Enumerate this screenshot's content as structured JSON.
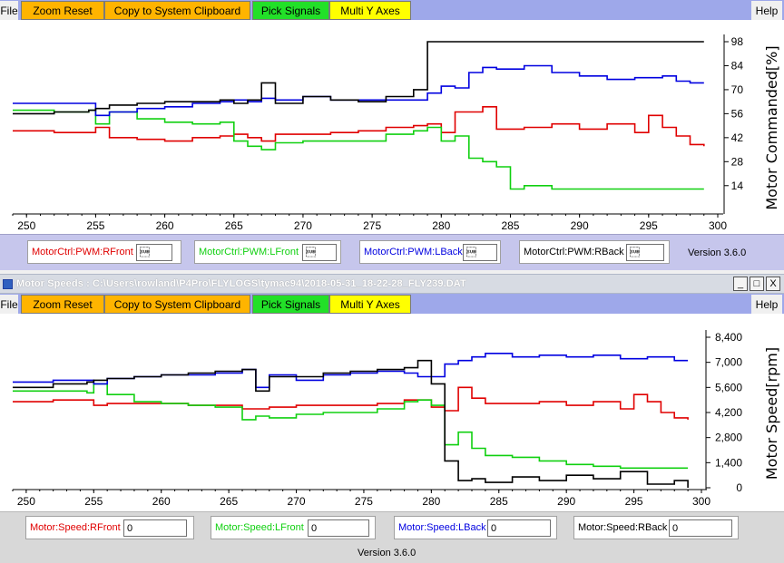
{
  "colors": {
    "rfront": "#e00000",
    "lfront": "#10d010",
    "lback": "#0000e0",
    "rback": "#000000"
  },
  "top_panel": {
    "menu": {
      "file": "File",
      "help": "Help"
    },
    "buttons": {
      "zoom_reset": "Zoom Reset",
      "copy": "Copy to System Clipboard",
      "pick": "Pick Signals",
      "multi": "Multi Y Axes"
    },
    "signals": [
      {
        "label": "MotorCtrl:PWM:RFront",
        "value": "\u001a"
      },
      {
        "label": "MotorCtrl:PWM:LFront",
        "value": "\u001a"
      },
      {
        "label": "MotorCtrl:PWM:LBack",
        "value": "\u001a"
      },
      {
        "label": "MotorCtrl:PWM:RBack",
        "value": "\u001a"
      }
    ],
    "version": "Version 3.6.0",
    "ylabel": "Motor Commanded[%]",
    "yticks": [
      "98",
      "84",
      "70",
      "56",
      "42",
      "28",
      "14"
    ],
    "xticks": [
      "250",
      "255",
      "260",
      "265",
      "270",
      "275",
      "280",
      "285",
      "290",
      "295",
      "300"
    ]
  },
  "window": {
    "title": "Motor Speeds : C:\\Users\\rowland\\P4Pro\\FLYLOGS\\tymac94\\2018-05-31_18-22-28_FLY239.DAT",
    "minimize": "_",
    "maximize": "□",
    "close": "X"
  },
  "bottom_panel": {
    "menu": {
      "file": "File",
      "help": "Help"
    },
    "buttons": {
      "zoom_reset": "Zoom Reset",
      "copy": "Copy to System Clipboard",
      "pick": "Pick Signals",
      "multi": "Multi Y Axes"
    },
    "signals": [
      {
        "label": "Motor:Speed:RFront",
        "value": "0"
      },
      {
        "label": "Motor:Speed:LFront",
        "value": "0"
      },
      {
        "label": "Motor:Speed:LBack",
        "value": "0"
      },
      {
        "label": "Motor:Speed:RBack",
        "value": "0"
      }
    ],
    "version": "Version 3.6.0",
    "ylabel": "Motor Speed[rpm]",
    "yticks": [
      "8,400",
      "7,000",
      "5,600",
      "4,200",
      "2,800",
      "1,400",
      "0"
    ],
    "xticks": [
      "250",
      "255",
      "260",
      "265",
      "270",
      "275",
      "280",
      "285",
      "290",
      "295",
      "300"
    ]
  },
  "chart_data": [
    {
      "type": "line",
      "ylabel": "Motor Commanded[%]",
      "xlim": [
        249,
        300
      ],
      "ylim": [
        7,
        98
      ],
      "series": [
        {
          "name": "MotorCtrl:PWM:RFront",
          "x": [
            249,
            252,
            254.5,
            255,
            256,
            258,
            260,
            262,
            264,
            265,
            266,
            267,
            268,
            270,
            272,
            274,
            276,
            278,
            279,
            280,
            281,
            282,
            283,
            284,
            286,
            288,
            290,
            292,
            294,
            295,
            296,
            297,
            298,
            299
          ],
          "y": [
            46,
            45,
            45,
            48,
            42,
            41,
            40,
            42,
            43,
            44,
            42,
            40,
            44,
            44,
            45,
            46,
            48,
            49,
            50,
            45,
            57,
            57,
            60,
            47,
            48,
            50,
            47,
            50,
            45,
            55,
            48,
            43,
            38,
            37
          ]
        },
        {
          "name": "MotorCtrl:PWM:LFront",
          "x": [
            249,
            252,
            254.5,
            255,
            256,
            258,
            260,
            262,
            264,
            265,
            266,
            267,
            268,
            270,
            272,
            274,
            276,
            278,
            279,
            280,
            281,
            282,
            283,
            284,
            285,
            286,
            288,
            290,
            292,
            294,
            296,
            297,
            298,
            299
          ],
          "y": [
            58,
            57,
            58,
            50,
            57,
            53,
            51,
            50,
            51,
            40,
            37,
            35,
            39,
            40,
            40,
            40,
            44,
            46,
            48,
            40,
            43,
            30,
            28,
            25,
            12,
            14,
            12,
            12,
            12,
            12,
            12,
            12,
            12,
            12
          ]
        },
        {
          "name": "MotorCtrl:PWM:LBack",
          "x": [
            249,
            252,
            254.5,
            255,
            256,
            258,
            260,
            262,
            264,
            265,
            266,
            267,
            268,
            270,
            272,
            274,
            276,
            278,
            279,
            280,
            281,
            282,
            283,
            284,
            286,
            288,
            290,
            292,
            294,
            296,
            297,
            298,
            299
          ],
          "y": [
            62,
            62,
            62,
            55,
            57,
            59,
            60,
            62,
            63,
            64,
            63,
            65,
            64,
            66,
            64,
            64,
            64,
            64,
            68,
            72,
            71,
            80,
            83,
            82,
            84,
            80,
            78,
            76,
            77,
            78,
            75,
            74,
            74
          ]
        },
        {
          "name": "MotorCtrl:PWM:RBack",
          "x": [
            249,
            252,
            254.5,
            255,
            256,
            258,
            260,
            262,
            264,
            265,
            266,
            267,
            268,
            270,
            272,
            274,
            276,
            278,
            279,
            280,
            281,
            282,
            283,
            284,
            286,
            288,
            290,
            292,
            294,
            296,
            298,
            299
          ],
          "y": [
            56,
            57,
            58,
            59,
            61,
            62,
            63,
            63,
            64,
            62,
            64,
            74,
            62,
            66,
            64,
            63,
            66,
            70,
            98,
            98,
            98,
            98,
            98,
            98,
            98,
            98,
            98,
            98,
            98,
            98,
            98,
            98
          ]
        }
      ]
    },
    {
      "type": "line",
      "ylabel": "Motor Speed[rpm]",
      "xlim": [
        249,
        300
      ],
      "ylim": [
        0,
        8400
      ],
      "series": [
        {
          "name": "Motor:Speed:RFront",
          "x": [
            249,
            252,
            254.5,
            255,
            256,
            258,
            260,
            262,
            264,
            266,
            268,
            270,
            272,
            274,
            276,
            278,
            279,
            280,
            281,
            282,
            283,
            284,
            286,
            288,
            290,
            292,
            294,
            295,
            296,
            297,
            298,
            299
          ],
          "y": [
            4800,
            4900,
            4900,
            4600,
            4700,
            4700,
            4700,
            4600,
            4600,
            4400,
            4500,
            4600,
            4600,
            4600,
            4700,
            4900,
            4900,
            4500,
            4300,
            5600,
            5000,
            4700,
            4700,
            4800,
            4600,
            4800,
            4400,
            5200,
            4800,
            4200,
            3900,
            3800
          ]
        },
        {
          "name": "Motor:Speed:LFront",
          "x": [
            249,
            252,
            254.5,
            255,
            256,
            258,
            260,
            262,
            264,
            266,
            267,
            268,
            270,
            272,
            274,
            276,
            278,
            279,
            280,
            281,
            282,
            283,
            284,
            286,
            288,
            290,
            292,
            294,
            296,
            298,
            299
          ],
          "y": [
            5400,
            5400,
            5300,
            5800,
            5200,
            4800,
            4700,
            4600,
            4500,
            3800,
            4000,
            3900,
            4100,
            4200,
            4200,
            4400,
            4800,
            4900,
            4600,
            2400,
            3100,
            2200,
            1800,
            1700,
            1500,
            1300,
            1200,
            1100,
            1100,
            1100,
            1100
          ]
        },
        {
          "name": "Motor:Speed:LBack",
          "x": [
            249,
            252,
            254.5,
            255,
            256,
            258,
            260,
            262,
            264,
            266,
            267,
            268,
            270,
            272,
            274,
            276,
            278,
            279,
            280,
            281,
            282,
            283,
            284,
            286,
            288,
            290,
            292,
            294,
            296,
            298,
            299
          ],
          "y": [
            5900,
            6000,
            6000,
            5800,
            6100,
            6200,
            6300,
            6300,
            6400,
            6600,
            5600,
            6300,
            6000,
            6300,
            6400,
            6500,
            6400,
            6200,
            6200,
            6900,
            7100,
            7300,
            7500,
            7300,
            7400,
            7300,
            7400,
            7200,
            7300,
            7100,
            7100
          ]
        },
        {
          "name": "Motor:Speed:RBack",
          "x": [
            249,
            252,
            254.5,
            255,
            256,
            258,
            260,
            262,
            264,
            266,
            267,
            268,
            270,
            272,
            274,
            276,
            278,
            279,
            280,
            281,
            282,
            283,
            284,
            286,
            288,
            290,
            292,
            294,
            296,
            298,
            299
          ],
          "y": [
            5600,
            5800,
            5900,
            6000,
            6100,
            6200,
            6300,
            6400,
            6500,
            6600,
            5400,
            6200,
            6200,
            6400,
            6500,
            6600,
            6700,
            7100,
            5800,
            1500,
            400,
            500,
            300,
            600,
            400,
            700,
            500,
            900,
            200,
            400,
            0
          ]
        }
      ]
    }
  ]
}
